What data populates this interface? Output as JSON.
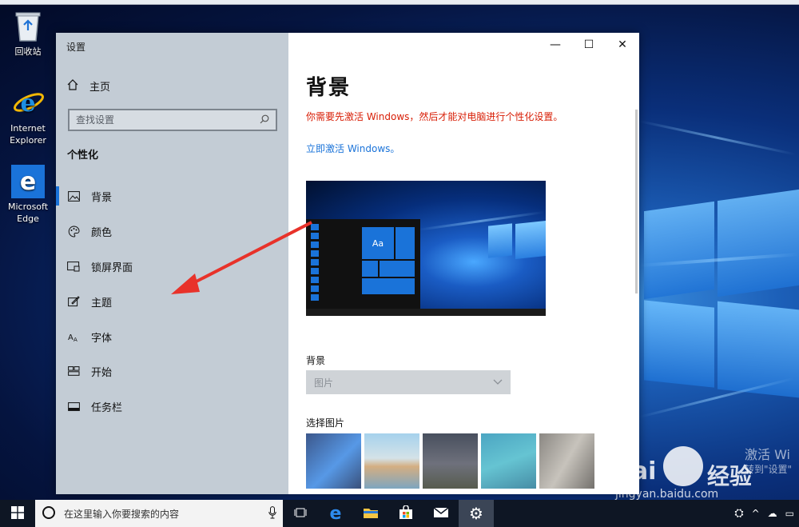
{
  "desktop": {
    "icons": [
      {
        "label": "回收站"
      },
      {
        "label": "Internet Explorer"
      },
      {
        "label": "Microsoft Edge"
      }
    ],
    "watermark": {
      "activate_title": "激活 Wi",
      "activate_sub": "转到\"设置\"",
      "baidu_brand": "Bai",
      "baidu_jingyan": "经验",
      "baidu_url": "jingyan.baidu.com"
    }
  },
  "window": {
    "title": "设置",
    "controls": {
      "minimize": "—",
      "maximize": "☐",
      "close": "✕"
    },
    "nav": {
      "home_label": "主页",
      "search_placeholder": "查找设置",
      "section_title": "个性化",
      "items": [
        {
          "label": "背景",
          "icon": "picture-icon",
          "selected": true
        },
        {
          "label": "颜色",
          "icon": "palette-icon"
        },
        {
          "label": "锁屏界面",
          "icon": "lock-screen-icon"
        },
        {
          "label": "主题",
          "icon": "theme-icon"
        },
        {
          "label": "字体",
          "icon": "font-icon"
        },
        {
          "label": "开始",
          "icon": "start-icon"
        },
        {
          "label": "任务栏",
          "icon": "taskbar-icon"
        }
      ]
    },
    "content": {
      "heading": "背景",
      "warning": "你需要先激活 Windows，然后才能对电脑进行个性化设置。",
      "activate_link": "立即激活 Windows。",
      "preview_tile_text": "Aa",
      "background_label": "背景",
      "background_value": "图片",
      "choose_picture_label": "选择图片"
    }
  },
  "taskbar": {
    "search_placeholder": "在这里输入你要搜索的内容"
  },
  "colors": {
    "accent": "#1a73d9",
    "warning": "#d81e06",
    "nav_bg": "#c3ccd5",
    "taskbar": "#0e1624"
  }
}
